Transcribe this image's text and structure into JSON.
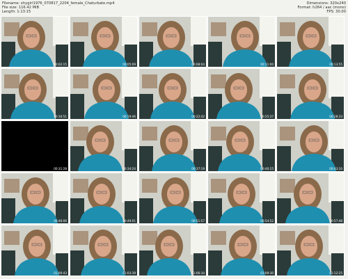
{
  "meta": {
    "filename": "Filename: xhygirl1976_070817_2204_female_Chaturbate.mp4",
    "filesize": "File size: 116.42 MiB",
    "length": "Length: 1:13:15",
    "dimensions": "Dimensions: 320x240",
    "format": "Format: h264 / aac (mono)",
    "fps": "FPS: 30.00"
  },
  "frames": [
    {
      "ts": "00:02:15",
      "style": "normal"
    },
    {
      "ts": "00:05:09",
      "style": "normal"
    },
    {
      "ts": "00:08:04",
      "style": "normal"
    },
    {
      "ts": "00:11:00",
      "style": "normal"
    },
    {
      "ts": "00:13:55",
      "style": "normal"
    },
    {
      "ts": "00:16:51",
      "style": "normal"
    },
    {
      "ts": "00:19:46",
      "style": "normal"
    },
    {
      "ts": "00:22:42",
      "style": "normal"
    },
    {
      "ts": "00:25:37",
      "style": "normal"
    },
    {
      "ts": "00:28:33",
      "style": "normal"
    },
    {
      "ts": "00:31:28",
      "style": "black"
    },
    {
      "ts": "00:34:24",
      "style": "normal"
    },
    {
      "ts": "00:37:19",
      "style": "normal"
    },
    {
      "ts": "00:40:15",
      "style": "normal"
    },
    {
      "ts": "00:43:10",
      "style": "normal"
    },
    {
      "ts": "00:46:06",
      "style": "normal"
    },
    {
      "ts": "00:49:01",
      "style": "normal"
    },
    {
      "ts": "00:51:57",
      "style": "normal"
    },
    {
      "ts": "00:54:52",
      "style": "normal"
    },
    {
      "ts": "00:57:48",
      "style": "normal"
    },
    {
      "ts": "01:00:43",
      "style": "normal"
    },
    {
      "ts": "01:03:39",
      "style": "normal"
    },
    {
      "ts": "01:06:34",
      "style": "normal"
    },
    {
      "ts": "01:09:30",
      "style": "normal"
    },
    {
      "ts": "01:12:25",
      "style": "normal"
    }
  ],
  "colors": {
    "shirt": "#1f8fb0",
    "hair": "#8a6a4a",
    "skin": "#d9a68a",
    "wall": "#cfd0c8",
    "window": "#f4f4ee",
    "shelf": "#9a7b5c",
    "chair": "#2b3b3a"
  }
}
